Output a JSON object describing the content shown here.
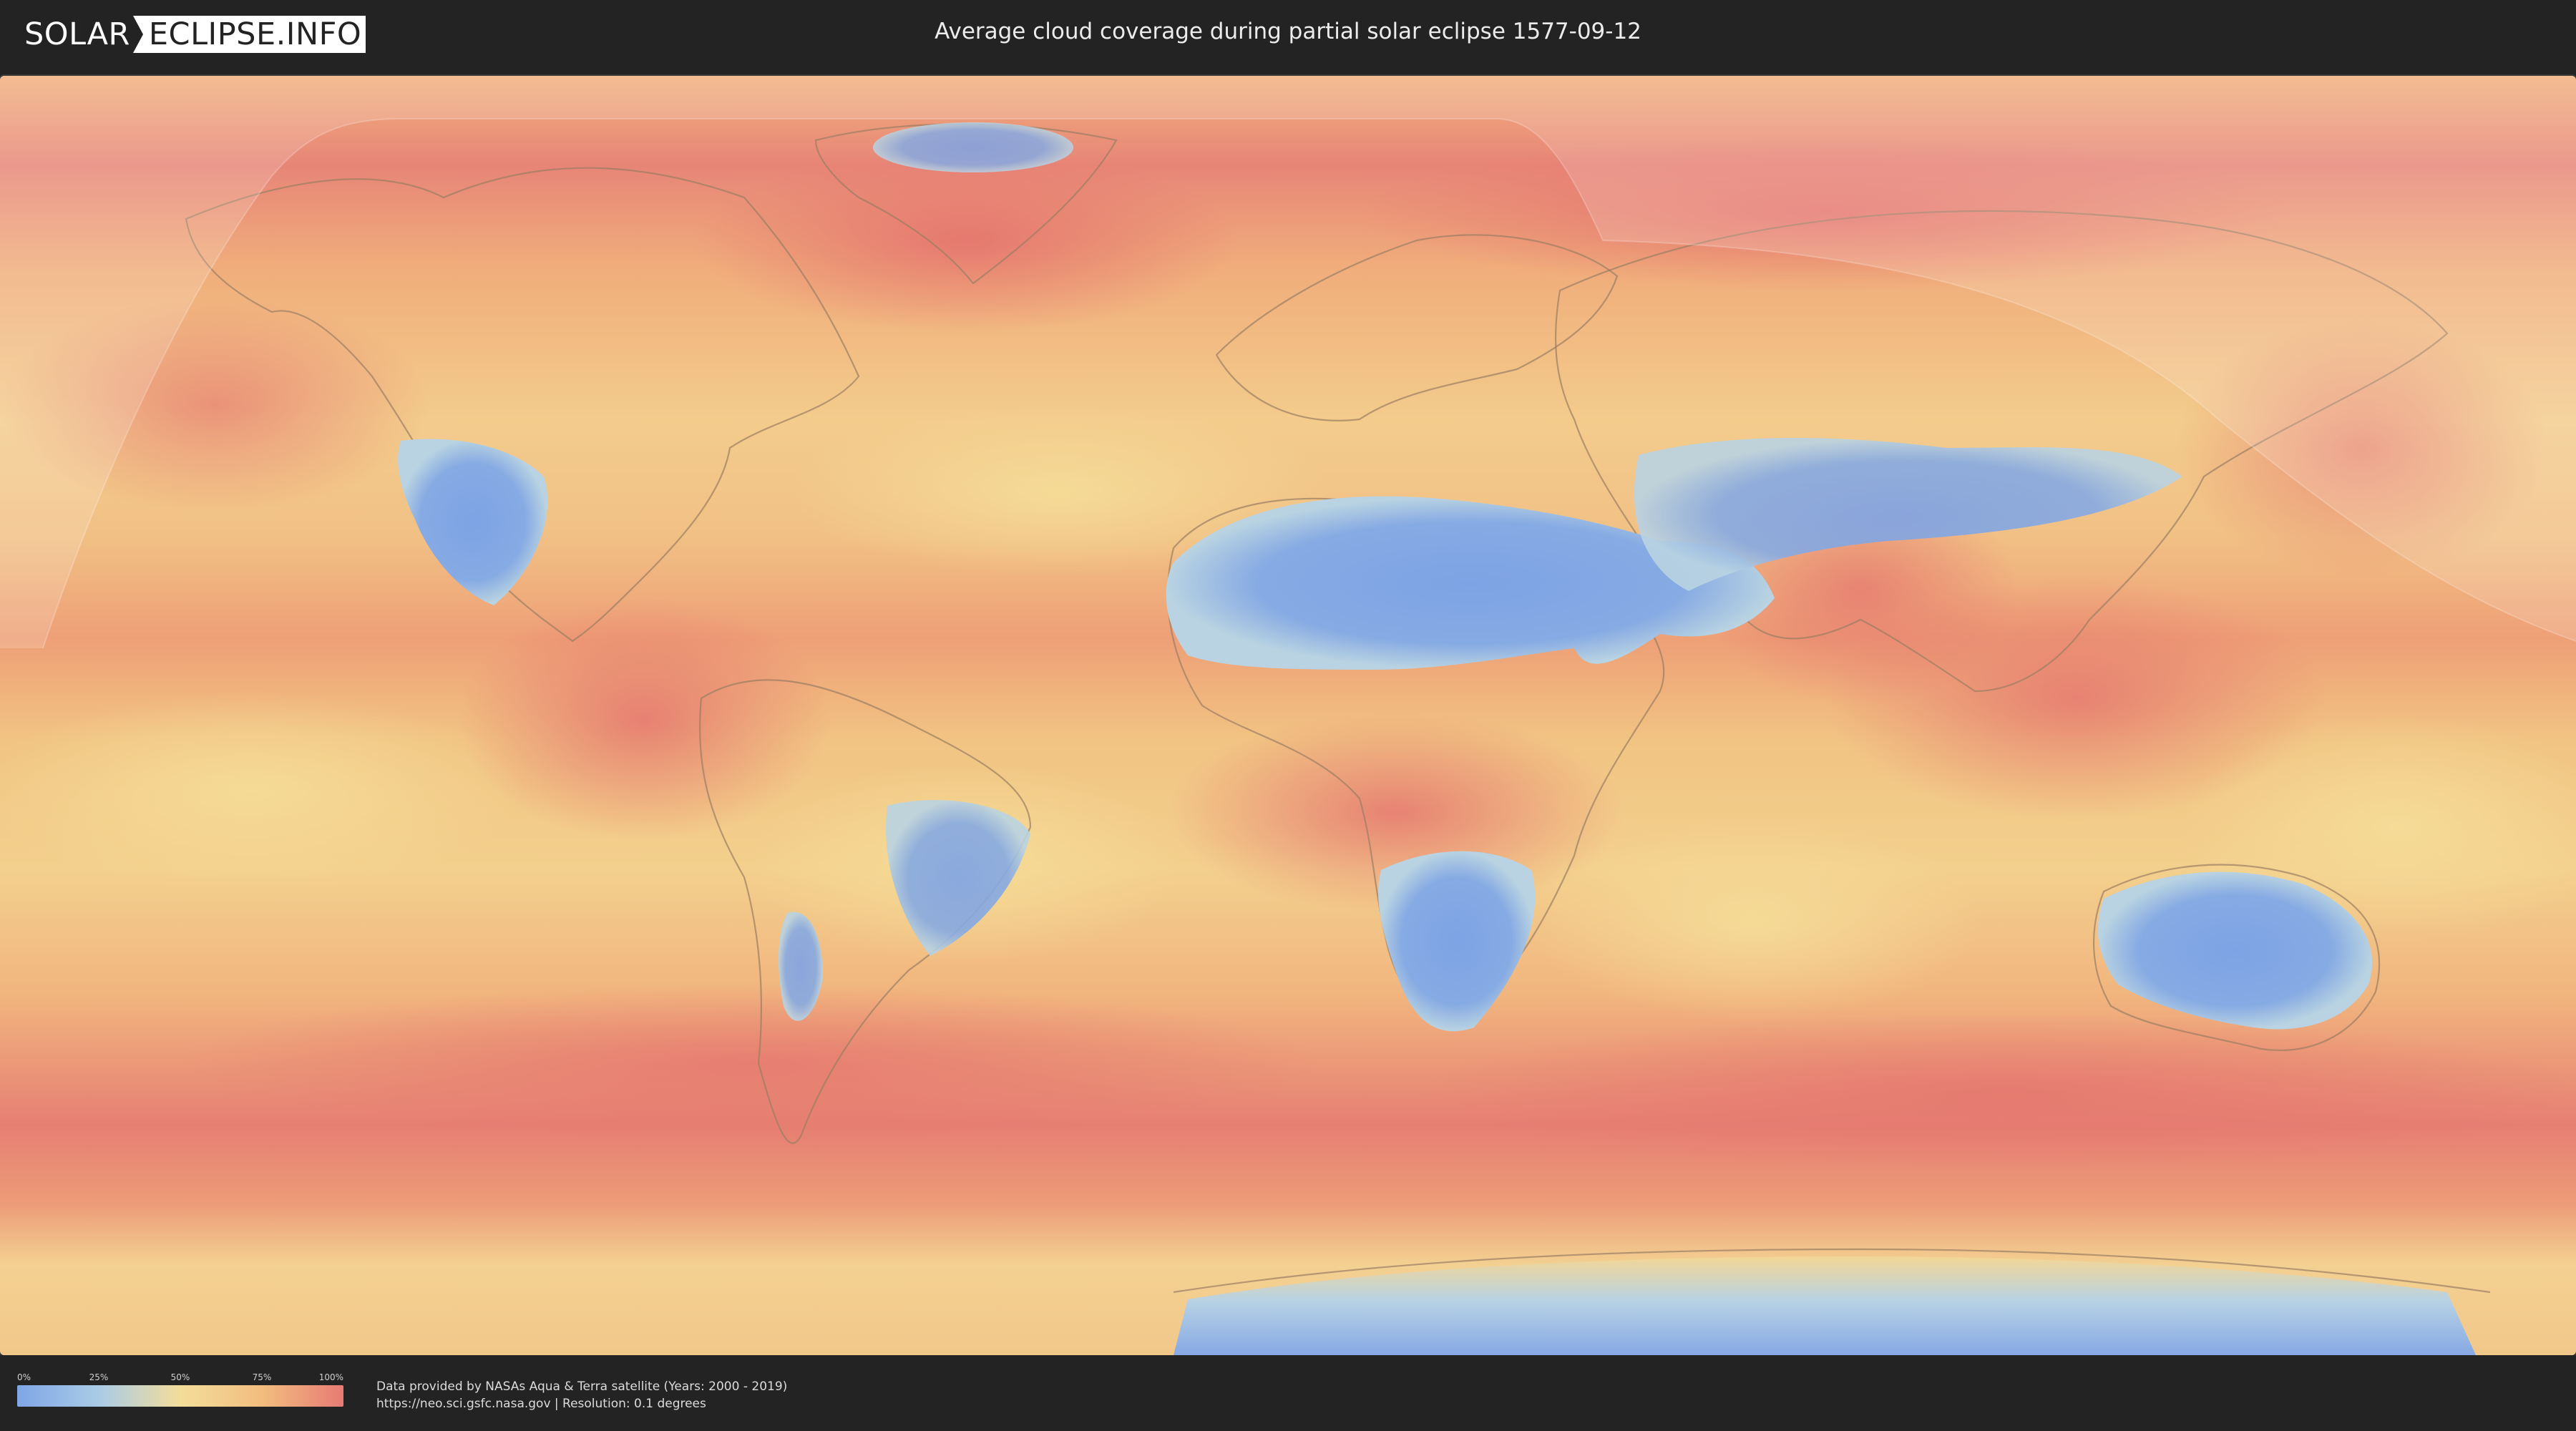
{
  "header": {
    "logo_part1": "SOLAR",
    "logo_part2": "ECLIPSE.INFO",
    "title": "Average cloud coverage during partial solar eclipse 1577-09-12"
  },
  "map": {
    "layer": "average-cloud-coverage",
    "overlay": "partial-eclipse-visibility-zone",
    "colors": {
      "low_cloud": "#7fa6e6",
      "mid_low": "#aacbe6",
      "mid": "#f3dd9a",
      "mid_high": "#f2bd7f",
      "high_cloud": "#e77b74",
      "overlay": "#ffffff"
    }
  },
  "legend": {
    "ticks": [
      "0%",
      "25%",
      "50%",
      "75%",
      "100%"
    ],
    "gradient": [
      "#7fa6e6",
      "#aacbe6",
      "#f3dd9a",
      "#f2bd7f",
      "#e77b74"
    ]
  },
  "credits": {
    "line1": "Data provided by NASAs Aqua & Terra satellite (Years: 2000 - 2019)",
    "line2": "https://neo.sci.gsfc.nasa.gov | Resolution: 0.1 degrees"
  }
}
